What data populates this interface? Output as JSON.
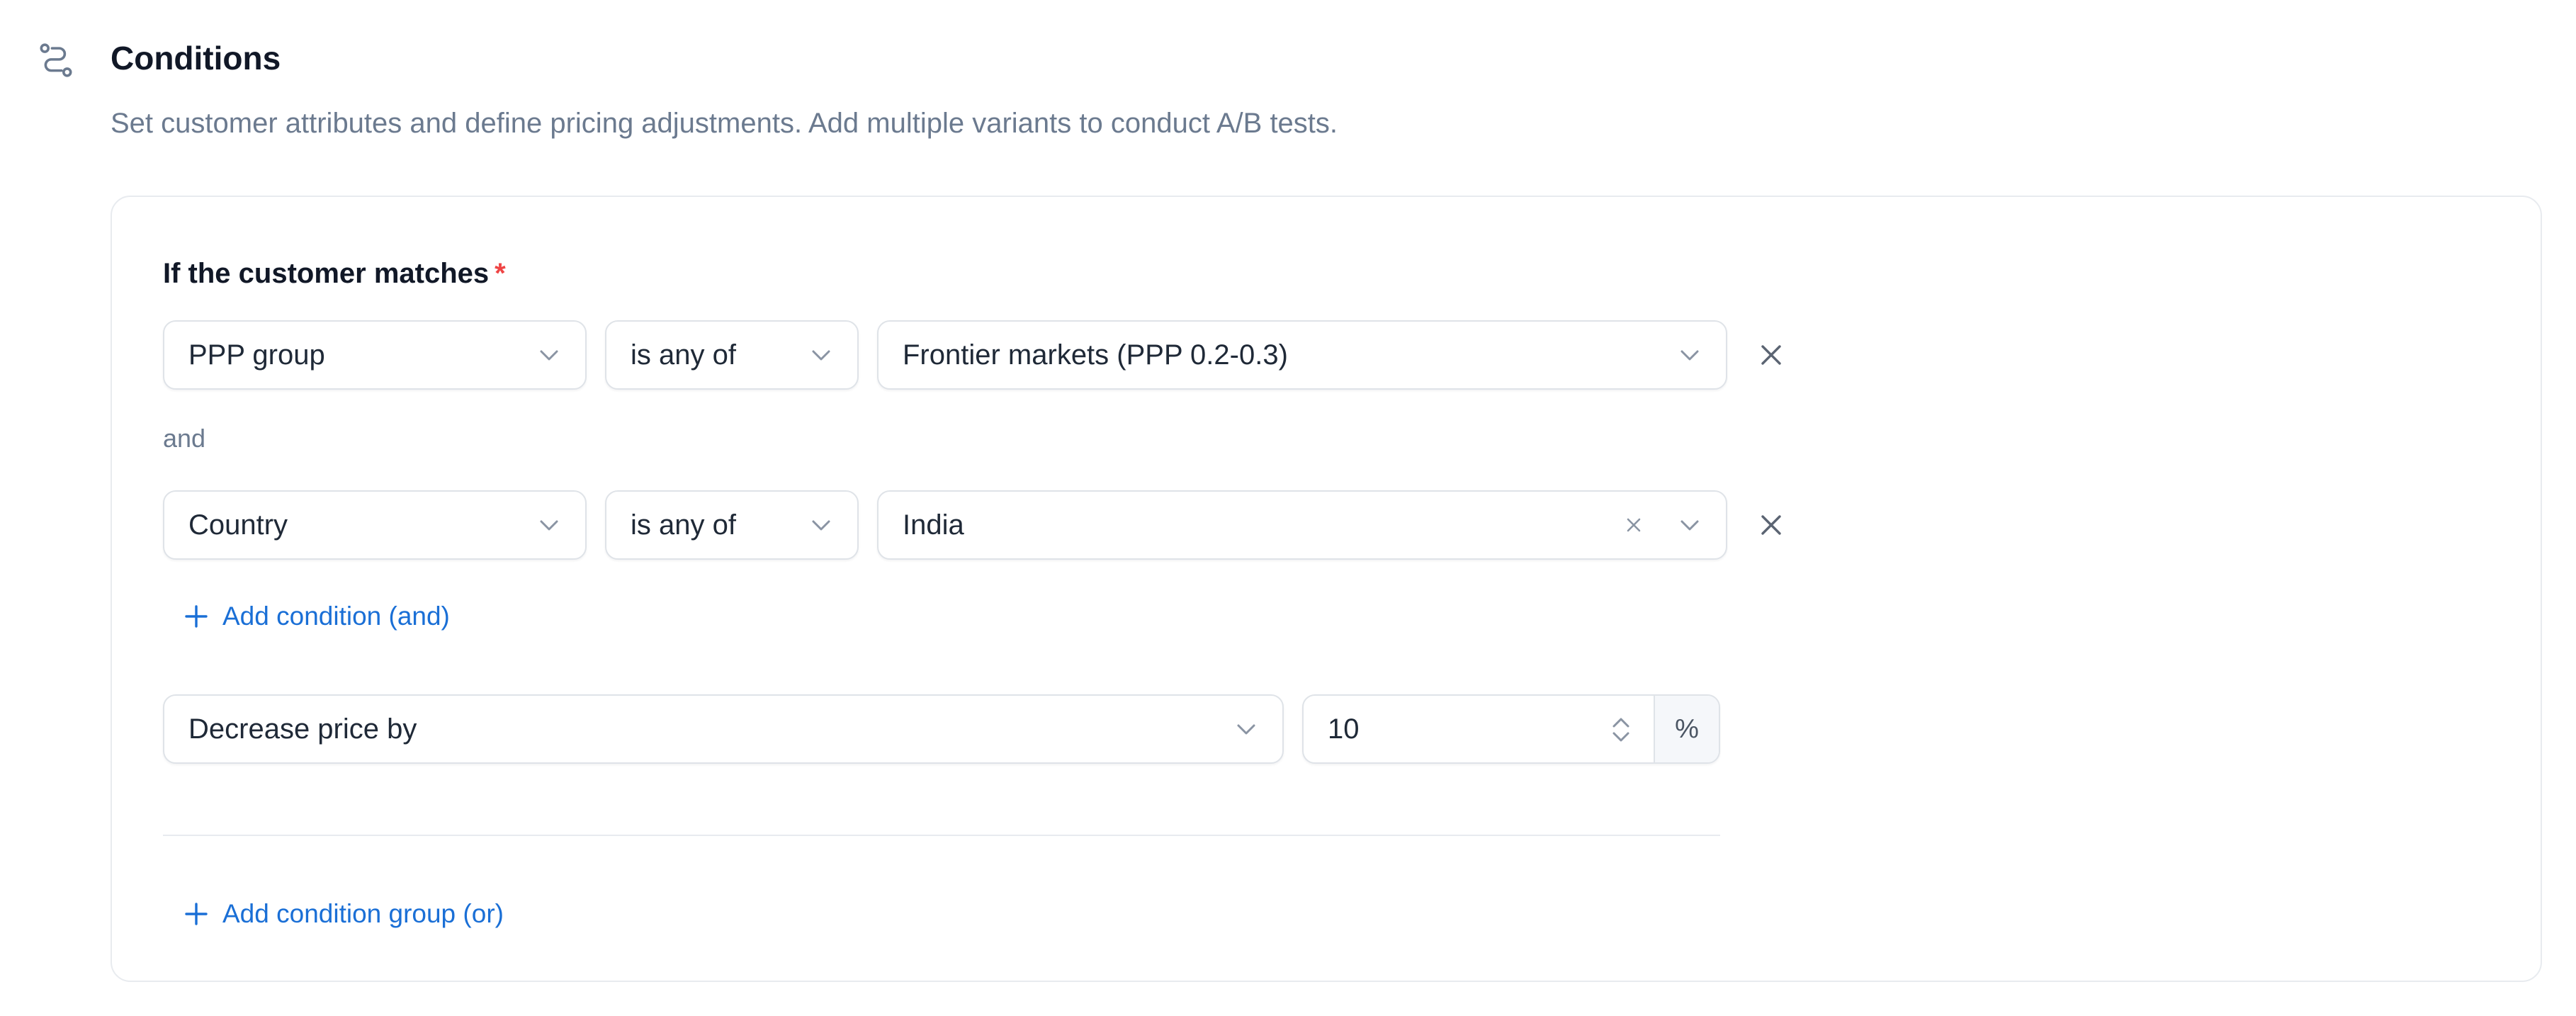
{
  "section": {
    "title": "Conditions",
    "description": "Set customer attributes and define pricing adjustments. Add multiple variants to conduct A/B tests."
  },
  "group": {
    "match_label": "If the customer matches",
    "required_mark": "*",
    "conditions": [
      {
        "attribute": "PPP group",
        "operator": "is any of",
        "value": "Frontier markets (PPP 0.2-0.3)",
        "clearable": false
      },
      {
        "attribute": "Country",
        "operator": "is any of",
        "value": "India",
        "clearable": true
      }
    ],
    "joiner": "and",
    "add_condition_label": "Add condition (and)",
    "adjustment": {
      "type": "Decrease price by",
      "amount": "10",
      "unit": "%"
    }
  },
  "add_group_label": "Add condition group (or)",
  "colors": {
    "link": "#1a6fd6",
    "required": "#ef4444",
    "muted_text": "#6b7a8f",
    "border": "#dfe3e8"
  }
}
